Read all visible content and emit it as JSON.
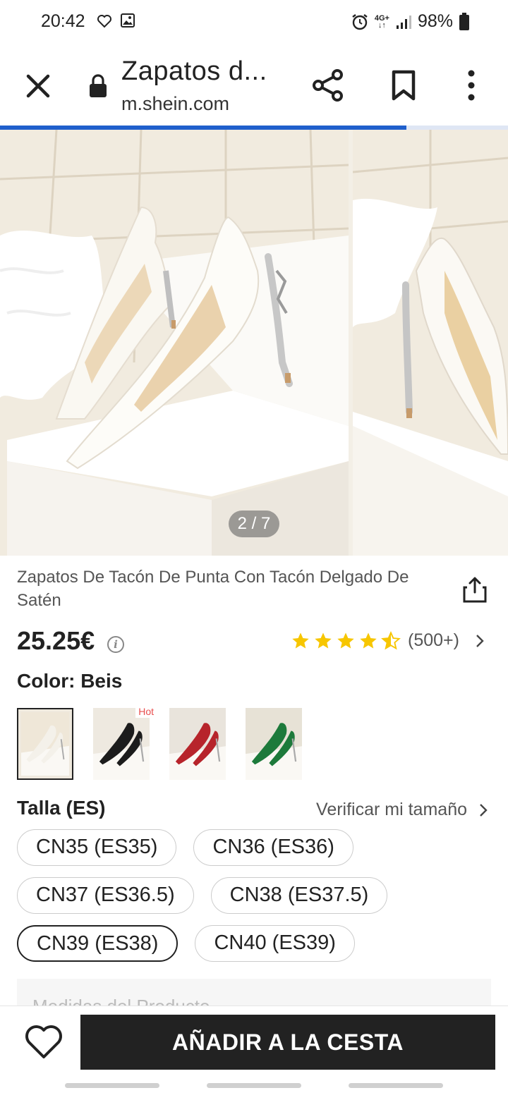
{
  "status_bar": {
    "time": "20:42",
    "left_icons": [
      "heart-outline-icon",
      "image-icon"
    ],
    "network": "4G+",
    "battery": "98%"
  },
  "browser": {
    "page_title": "Zapatos d...",
    "url": "m.shein.com",
    "load_progress": 0.8
  },
  "gallery": {
    "counter": "2 / 7"
  },
  "product": {
    "title": "Zapatos De Tacón De Punta Con Tacón Delgado De Satén",
    "price": "25.25€",
    "price_info_icon": "i",
    "rating": 4.5,
    "rating_count": "(500+)",
    "color_label": "Color: Beis",
    "swatches": [
      {
        "name": "beige",
        "color": "#efe7d8",
        "shoe": "#f4f1ea",
        "selected": true,
        "badge": ""
      },
      {
        "name": "black",
        "color": "#eee9e0",
        "shoe": "#1c1c1c",
        "selected": false,
        "badge": "Hot"
      },
      {
        "name": "red",
        "color": "#e9e4dc",
        "shoe": "#b7242b",
        "selected": false,
        "badge": ""
      },
      {
        "name": "green",
        "color": "#e7e2d6",
        "shoe": "#1d7a3b",
        "selected": false,
        "badge": ""
      }
    ],
    "size_label": "Talla (ES)",
    "size_guide": "Verificar mi tamaño",
    "sizes": [
      [
        "CN35 (ES35)",
        "CN36 (ES36)"
      ],
      [
        "CN37 (ES36.5)",
        "CN38 (ES37.5)"
      ],
      [
        "CN39 (ES38)",
        "CN40 (ES39)"
      ]
    ],
    "selected_size": "CN39 (ES38)",
    "details_section": "Medidas del Producto"
  },
  "bottom_bar": {
    "add_to_cart": "AÑADIR A LA CESTA"
  },
  "colors": {
    "accent": "#1f5fcc",
    "button_bg": "#222222",
    "star": "#f7c600",
    "hot": "#e84d4d"
  }
}
